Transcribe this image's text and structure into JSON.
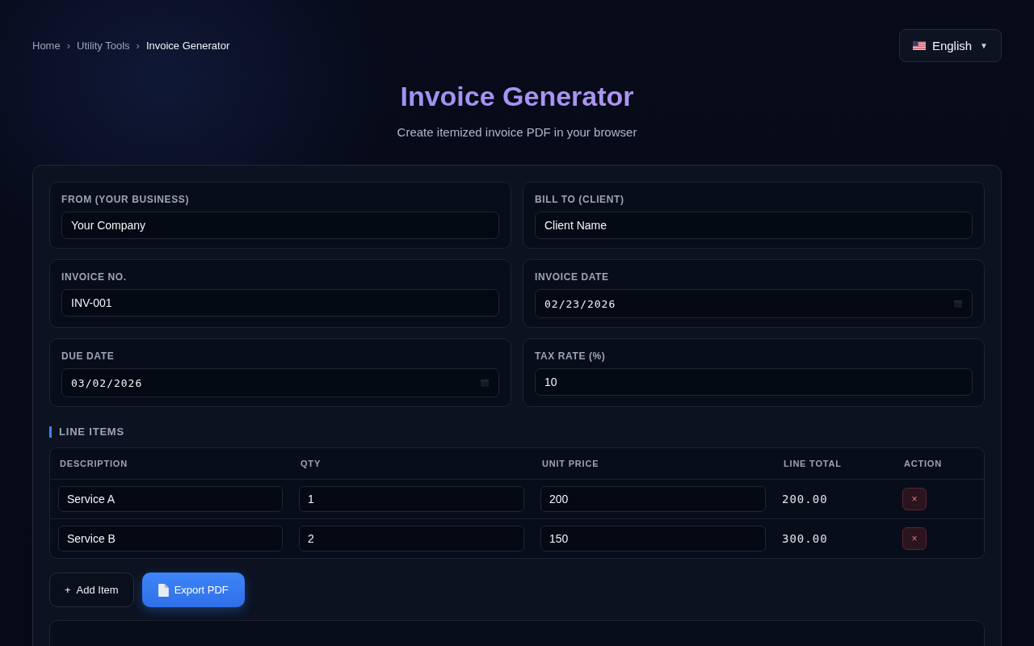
{
  "breadcrumb": [
    {
      "label": "Home",
      "current": false
    },
    {
      "label": "Utility Tools",
      "current": false
    },
    {
      "label": "Invoice Generator",
      "current": true
    }
  ],
  "breadcrumb_separator": "›",
  "language": {
    "label": "English",
    "caret": "▼"
  },
  "title": "Invoice Generator",
  "subtitle": "Create itemized invoice PDF in your browser",
  "fields": [
    {
      "label": "FROM (YOUR BUSINESS)",
      "value": "Your Company",
      "kind": "text"
    },
    {
      "label": "BILL TO (CLIENT)",
      "value": "Client Name",
      "kind": "text"
    },
    {
      "label": "INVOICE NO.",
      "value": "INV-001",
      "kind": "text"
    },
    {
      "label": "INVOICE DATE",
      "value": "02/23/2026",
      "kind": "date"
    },
    {
      "label": "DUE DATE",
      "value": "03/02/2026",
      "kind": "date"
    },
    {
      "label": "TAX RATE (%)",
      "value": "10",
      "kind": "text"
    }
  ],
  "line_items": {
    "title": "LINE ITEMS",
    "columns": [
      "DESCRIPTION",
      "QTY",
      "UNIT PRICE",
      "LINE TOTAL",
      "ACTION"
    ],
    "rows": [
      {
        "description": "Service A",
        "qty": "1",
        "unit_price": "200",
        "line_total": "200.00",
        "delete": "×"
      },
      {
        "description": "Service B",
        "qty": "2",
        "unit_price": "150",
        "line_total": "300.00",
        "delete": "×"
      }
    ]
  },
  "buttons": [
    {
      "label": "Add Item",
      "icon": "+",
      "kind": "secondary"
    },
    {
      "label": "Export PDF",
      "kind": "primary"
    }
  ]
}
